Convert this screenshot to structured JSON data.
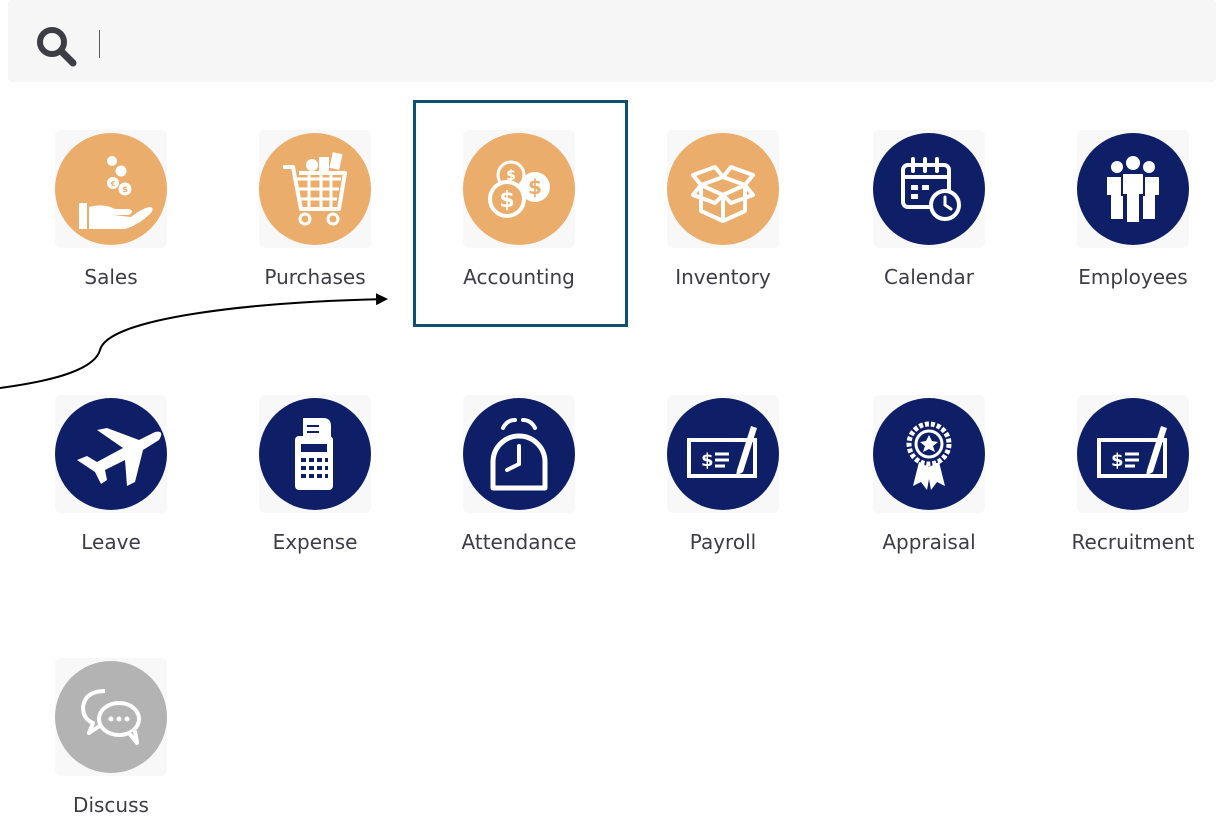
{
  "search": {
    "value": "",
    "icon": "search-icon"
  },
  "colors": {
    "orange": "#ebad6b",
    "navy": "#0f1f67",
    "grey": "#b3b3b3",
    "highlight": "#0e4f72"
  },
  "apps": [
    {
      "label": "Sales",
      "icon": "coins-hand-icon",
      "color": "orange"
    },
    {
      "label": "Purchases",
      "icon": "shopping-cart-icon",
      "color": "orange"
    },
    {
      "label": "Accounting",
      "icon": "dollar-coins-icon",
      "color": "orange",
      "highlighted": true
    },
    {
      "label": "Inventory",
      "icon": "open-box-icon",
      "color": "orange"
    },
    {
      "label": "Calendar",
      "icon": "calendar-clock-icon",
      "color": "navy"
    },
    {
      "label": "Employees",
      "icon": "people-group-icon",
      "color": "navy"
    },
    {
      "label": "Leave",
      "icon": "airplane-icon",
      "color": "navy"
    },
    {
      "label": "Expense",
      "icon": "calculator-receipt-icon",
      "color": "navy"
    },
    {
      "label": "Attendance",
      "icon": "alarm-clock-icon",
      "color": "navy"
    },
    {
      "label": "Payroll",
      "icon": "check-pen-icon",
      "color": "navy"
    },
    {
      "label": "Appraisal",
      "icon": "award-badge-icon",
      "color": "navy"
    },
    {
      "label": "Recruitment",
      "icon": "check-pen-icon",
      "color": "navy"
    },
    {
      "label": "Discuss",
      "icon": "chat-bubbles-icon",
      "color": "grey"
    }
  ]
}
